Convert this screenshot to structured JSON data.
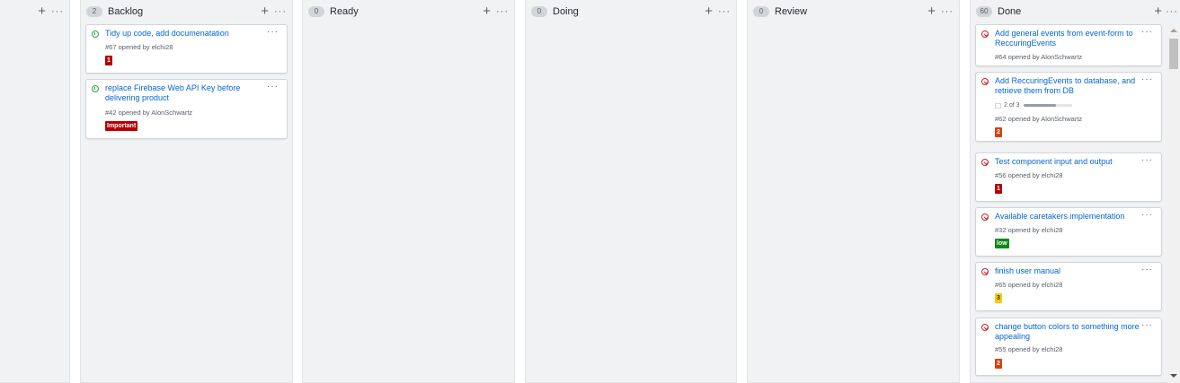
{
  "columns": [
    {
      "title": "",
      "count": ""
    },
    {
      "title": "Backlog",
      "count": "2"
    },
    {
      "title": "Ready",
      "count": "0"
    },
    {
      "title": "Doing",
      "count": "0"
    },
    {
      "title": "Review",
      "count": "0"
    },
    {
      "title": "Done",
      "count": "60"
    }
  ],
  "icons": {
    "add": "+",
    "more": "···"
  },
  "backlog": [
    {
      "title": "Tidy up code, add documenatation",
      "meta": "#67 opened by elchi28",
      "label": "1",
      "label_color": "#b60205"
    },
    {
      "title": "replace Firebase Web API Key before delivering product",
      "meta": "#42 opened by AlonSchwartz",
      "label": "Important",
      "label_color": "#b60205"
    }
  ],
  "done": [
    {
      "title": "Add general events from event-form to ReccuringEvents",
      "meta": "#64 opened by AlonSchwartz"
    },
    {
      "title": "Add ReccuringEvents to database, and retrieve them from DB",
      "progress": "2 of 3",
      "progress_fraction": 0.667,
      "meta": "#62 opened by AlonSchwartz",
      "label": "2",
      "label_color": "#d93f0b"
    },
    {
      "title": "Test component input and output",
      "meta": "#56 opened by elchi28",
      "label": "1",
      "label_color": "#b60205"
    },
    {
      "title": "Available caretakers implementation",
      "meta": "#32 opened by elchi28",
      "label": "low",
      "label_color": "#0e8a16"
    },
    {
      "title": "finish user manual",
      "meta": "#65 opened by elchi28",
      "label": "3",
      "label_color": "#fbca04",
      "label_text_color": "#24292e"
    },
    {
      "title": "change button colors to something more appealing",
      "meta": "#55 opened by elchi28",
      "label": "2",
      "label_color": "#d93f0b"
    }
  ]
}
